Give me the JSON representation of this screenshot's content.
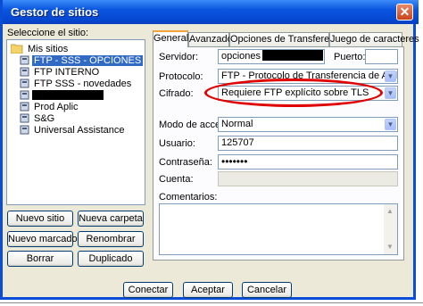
{
  "window": {
    "title": "Gestor de sitios",
    "close_glyph": "✕"
  },
  "site_tree": {
    "label": "Seleccione el sitio:",
    "root": "Mis sitios",
    "items": [
      {
        "label": "FTP - SSS - OPCIONES",
        "selected": true
      },
      {
        "label": "FTP INTERNO"
      },
      {
        "label": "FTP SSS - novedades"
      },
      {
        "label": "",
        "redacted": true
      },
      {
        "label": "Prod Aplic"
      },
      {
        "label": "S&G"
      },
      {
        "label": "Universal Assistance"
      }
    ]
  },
  "left_buttons": {
    "new_site": "Nuevo sitio",
    "new_folder": "Nueva carpeta",
    "new_bookmark": "Nuevo marcador",
    "rename": "Renombrar",
    "delete": "Borrar",
    "duplicate": "Duplicado"
  },
  "tabs": [
    "General",
    "Avanzado",
    "Opciones de Transferencia",
    "Juego de caracteres"
  ],
  "form": {
    "server_label": "Servidor:",
    "server_value": "opciones",
    "port_label": "Puerto:",
    "port_value": "",
    "protocol_label": "Protocolo:",
    "protocol_value": "FTP - Protocolo de Transferencia de Archivos",
    "encryption_label": "Cifrado:",
    "encryption_value": "Requiere FTP explícito sobre TLS",
    "access_mode_label": "Modo de acceso:",
    "access_mode_value": "Normal",
    "user_label": "Usuario:",
    "user_value": "125707",
    "password_label": "Contraseña:",
    "password_value": "•••••••",
    "account_label": "Cuenta:",
    "account_value": "",
    "comments_label": "Comentarios:"
  },
  "bottom_buttons": {
    "connect": "Conectar",
    "accept": "Aceptar",
    "cancel": "Cancelar"
  },
  "colors": {
    "titlebar": "#0a55e0",
    "selection": "#316ac5",
    "highlight_ellipse": "#e00000"
  },
  "icons": {
    "root": "folder-icon",
    "site": "server-icon",
    "combo": "chevron-down-icon"
  }
}
